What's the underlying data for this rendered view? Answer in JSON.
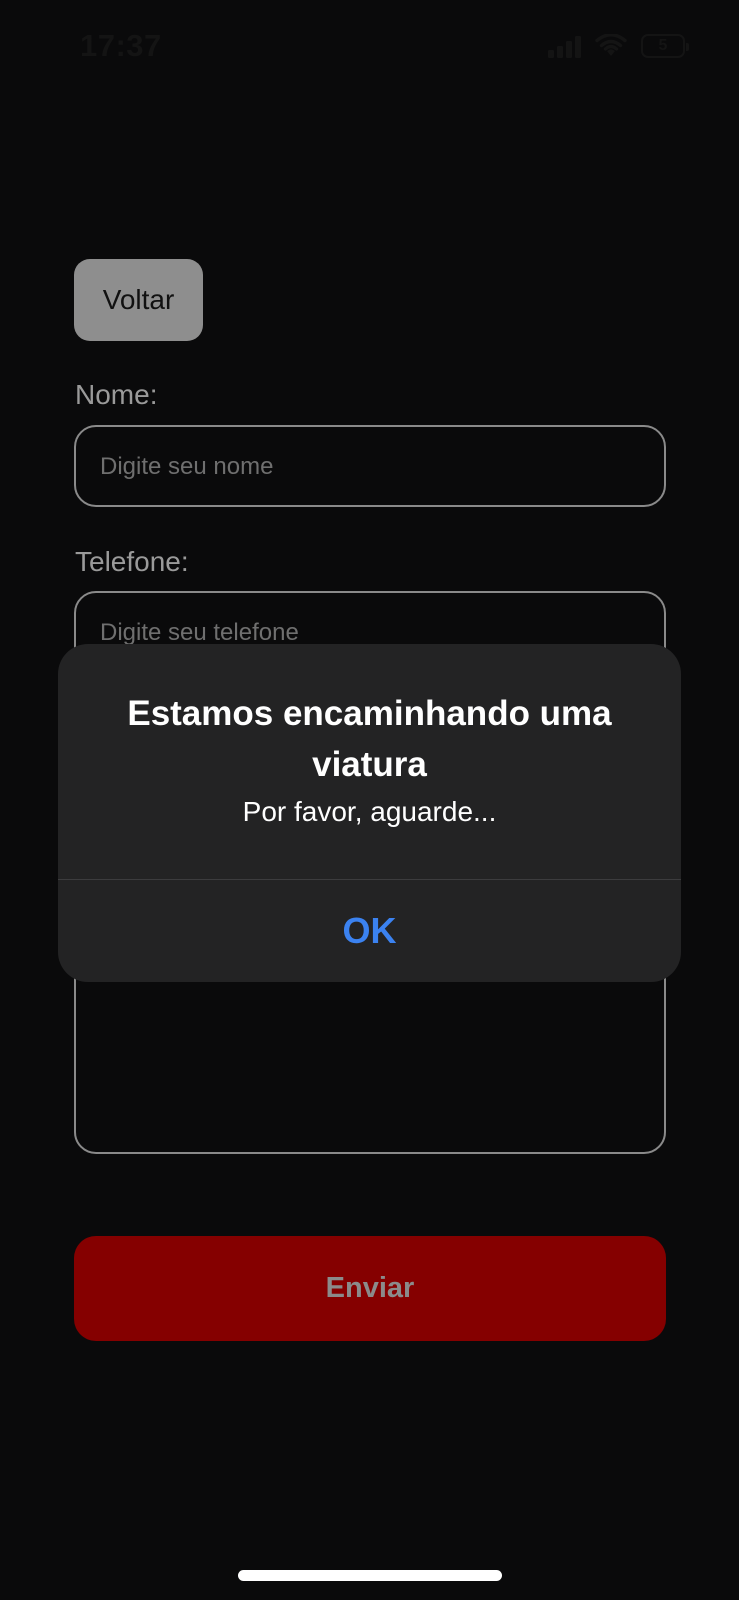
{
  "status_bar": {
    "time": "17:37",
    "battery": "5"
  },
  "form": {
    "back_label": "Voltar",
    "name_label": "Nome:",
    "name_placeholder": "Digite seu nome",
    "phone_label": "Telefone:",
    "phone_placeholder": "Digite seu telefone",
    "submit_label": "Enviar"
  },
  "alert": {
    "title": "Estamos encaminhando uma viatura",
    "message": "Por favor, aguarde...",
    "ok_label": "OK"
  },
  "colors": {
    "background": "#0a0a0b",
    "submit_button": "#850000",
    "alert_background": "#232324",
    "alert_action": "#3b82f0",
    "back_button": "#8e8e8e"
  }
}
